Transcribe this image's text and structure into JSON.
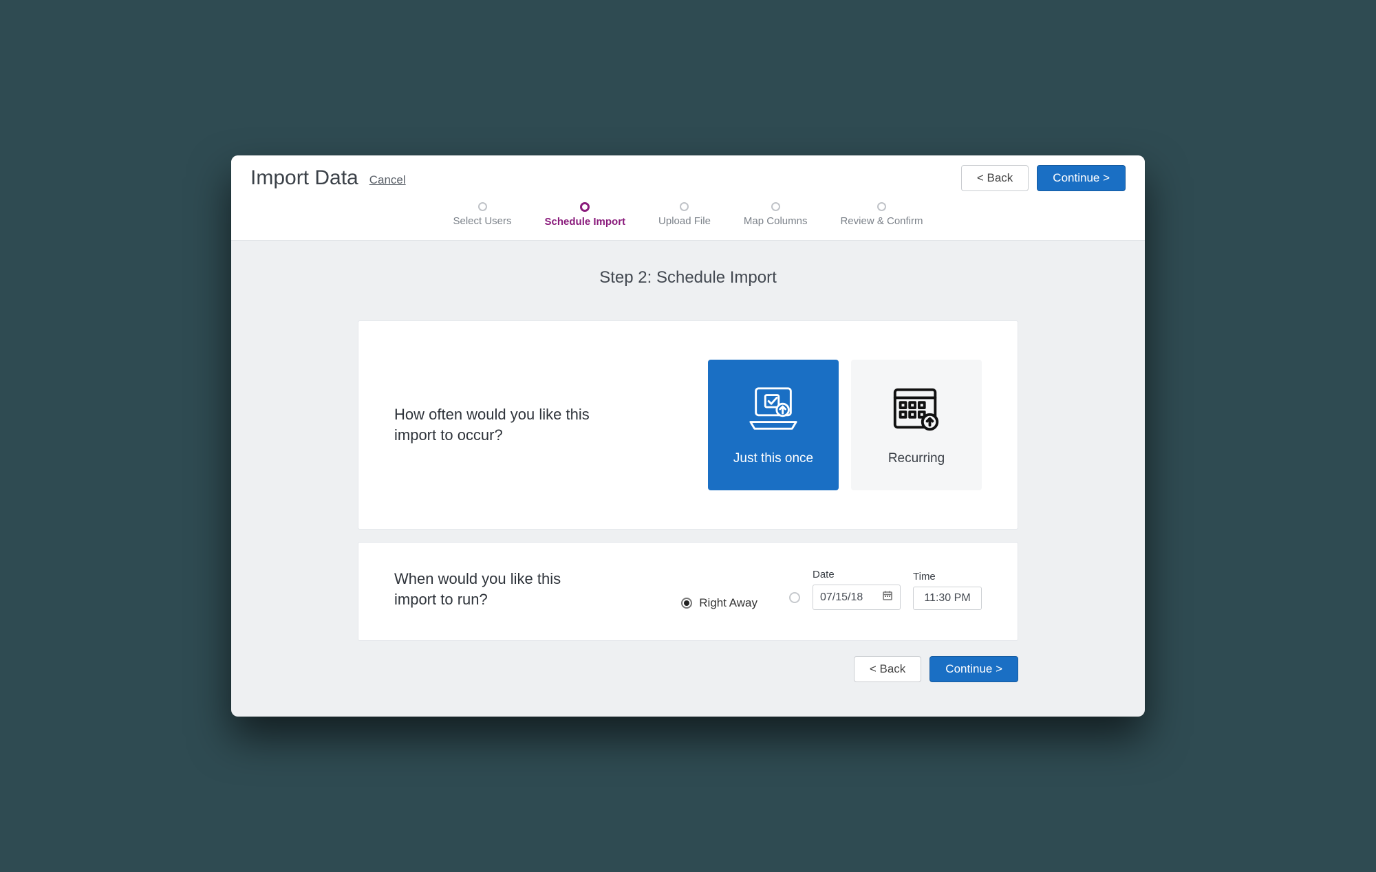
{
  "colors": {
    "primary": "#1a6fc4",
    "accent": "#8a1c7c",
    "page_bg": "#2f4b52",
    "panel_bg": "#eef0f2"
  },
  "header": {
    "title": "Import Data",
    "cancel_label": "Cancel",
    "back_label": "< Back",
    "continue_label": "Continue >"
  },
  "wizard": {
    "steps": [
      {
        "label": "Select Users",
        "active": false
      },
      {
        "label": "Schedule Import",
        "active": true
      },
      {
        "label": "Upload File",
        "active": false
      },
      {
        "label": "Map Columns",
        "active": false
      },
      {
        "label": "Review & Confirm",
        "active": false
      }
    ]
  },
  "page": {
    "heading": "Step 2: Schedule Import"
  },
  "frequency": {
    "question": "How often would you like this import to occur?",
    "options": {
      "once": {
        "label": "Just this once",
        "selected": true
      },
      "recurring": {
        "label": "Recurring",
        "selected": false
      }
    }
  },
  "when": {
    "question": "When would you like this import to run?",
    "right_away": {
      "label": "Right Away",
      "selected": true
    },
    "scheduled": {
      "selected": false
    },
    "date_label": "Date",
    "date_value": "07/15/18",
    "time_label": "Time",
    "time_value": "11:30 PM"
  },
  "footer": {
    "back_label": "< Back",
    "continue_label": "Continue >"
  }
}
